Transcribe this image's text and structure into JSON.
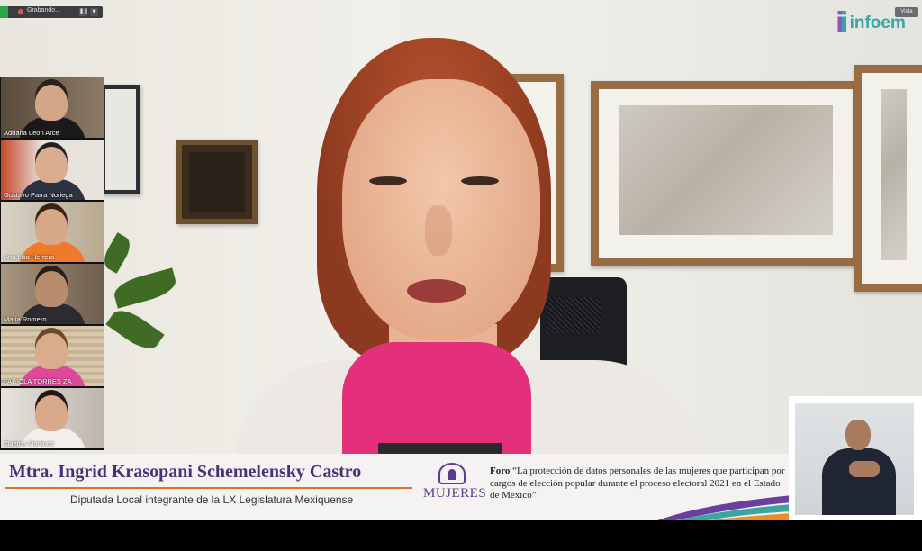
{
  "recording": {
    "status_text": "Grabando...",
    "pause_icon": "pause-icon",
    "stop_icon": "stop-icon"
  },
  "top_right": {
    "view_button": "Vista",
    "logo_brand": "infoem"
  },
  "participants": [
    {
      "name": "Adriana Leon Arce"
    },
    {
      "name": "Gustavo Parra Noriega"
    },
    {
      "name": "Ana Lilia Herrera"
    },
    {
      "name": "Maria Romero"
    },
    {
      "name": "FABIOLA TORRES ZA"
    },
    {
      "name": "Zulema Martinez"
    }
  ],
  "lower_third": {
    "speaker_name": "Mtra. Ingrid Krasopani Schemelensky Castro",
    "speaker_role": "Diputada Local integrante de la LX Legislatura Mexiquense",
    "event_logo_text": "MUJERES",
    "foro_label": "Foro",
    "foro_text": "“La protección de datos personales de las mujeres que participan por cargos de elección popular durante el proceso electoral 2021 en el Estado de México”"
  },
  "colors": {
    "accent_purple": "#4b2f78",
    "accent_orange": "#e0702a",
    "brand_teal": "#3aa6a1",
    "rec_green": "#2aa745"
  }
}
